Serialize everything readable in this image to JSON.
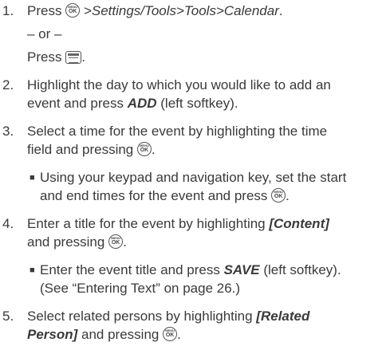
{
  "steps": {
    "s1": {
      "num": "1.",
      "text_a": "Press ",
      "path": ">Settings/Tools>Tools>Calendar",
      "text_b": ".",
      "or": "– or –",
      "press": "Press ",
      "press_end": "."
    },
    "s2": {
      "num": "2.",
      "line1": "Highlight the day to which you would like to add an",
      "line2_a": "event and press ",
      "line2_key": "ADD",
      "line2_b": " (left softkey)."
    },
    "s3": {
      "num": "3.",
      "line1": "Select a time for the event by highlighting the time",
      "line2": "field and pressing ",
      "line2_end": ".",
      "bullet_line1": "Using your keypad and navigation key, set the start",
      "bullet_line2": "and end times for the event and press ",
      "bullet_line2_end": "."
    },
    "s4": {
      "num": "4.",
      "line1_a": "Enter a title for the event by highlighting ",
      "line1_key": "[Content]",
      "line2": "and pressing ",
      "line2_end": ".",
      "bullet_line1_a": "Enter the event title and press ",
      "bullet_line1_key": "SAVE",
      "bullet_line1_b": " (left softkey).",
      "bullet_line2": "(See “Entering Text” on page 26.)"
    },
    "s5": {
      "num": "5.",
      "line1_a": "Select related persons by highlighting ",
      "line1_key": "[Related",
      "line2_key": "Person]",
      "line2": " and pressing ",
      "line2_end": "."
    }
  },
  "icons": {
    "ok_menu": "MENU",
    "ok_label": "OK"
  },
  "bullet_glyph": "■"
}
